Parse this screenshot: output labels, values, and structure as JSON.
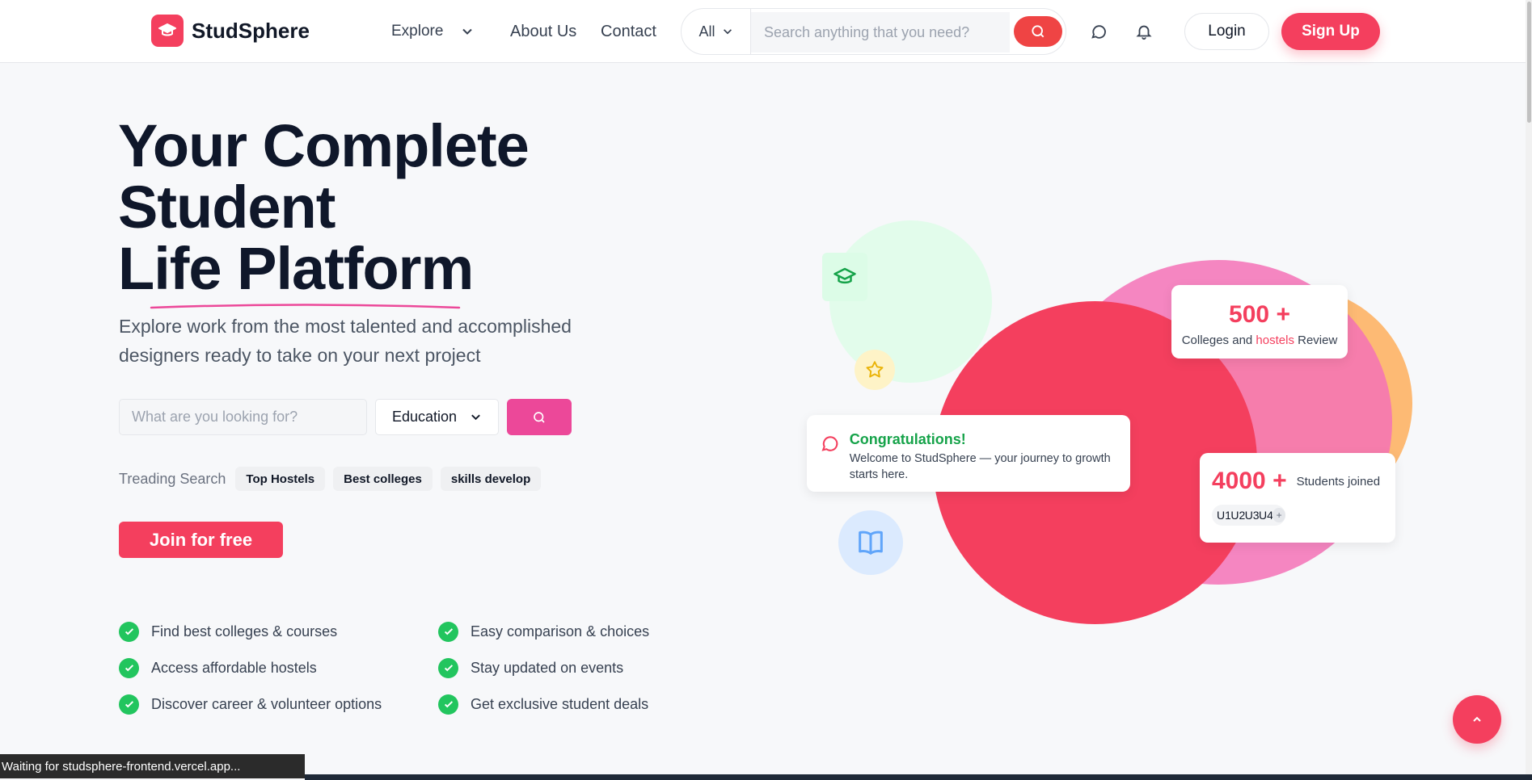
{
  "brand": {
    "name": "StudSphere",
    "accent": "#f43f5e",
    "logo_icon": "graduation-cap-icon"
  },
  "nav": {
    "explore_label": "Explore",
    "about_label": "About Us",
    "contact_label": "Contact",
    "search_category": "All",
    "search_placeholder": "Search anything that you need?",
    "login_label": "Login",
    "signup_label": "Sign Up"
  },
  "hero": {
    "title_line1": "Your Complete",
    "title_line2": "Student",
    "title_line3": "Life Platform",
    "subtitle": "Explore work from the most talented and accomplished designers ready to take on your next project",
    "find_placeholder": "What are you looking for?",
    "category_selected": "Education",
    "trending_label": "Treading Search",
    "trending_tags": [
      "Top Hostels",
      "Best colleges",
      "skills develop"
    ],
    "join_label": "Join for free"
  },
  "features": [
    "Find best colleges & courses",
    "Easy comparison & choices",
    "Access affordable hostels",
    "Stay updated on events",
    "Discover career & volunteer options",
    "Get exclusive student deals"
  ],
  "cards": {
    "congrats_title": "Congratulations!",
    "congrats_text": "Welcome to StudSphere — your journey to growth starts here.",
    "reviews_number": "500",
    "reviews_plus": "+",
    "reviews_pre": "Colleges and",
    "reviews_highlight": "hostels",
    "reviews_post": "Review",
    "students_number": "4000",
    "students_plus": "+",
    "students_label": "Students joined",
    "avatars": [
      "U1",
      "U2",
      "U3",
      "U4"
    ],
    "avatars_more": "+"
  },
  "status_text": "Waiting for studsphere-frontend.vercel.app..."
}
